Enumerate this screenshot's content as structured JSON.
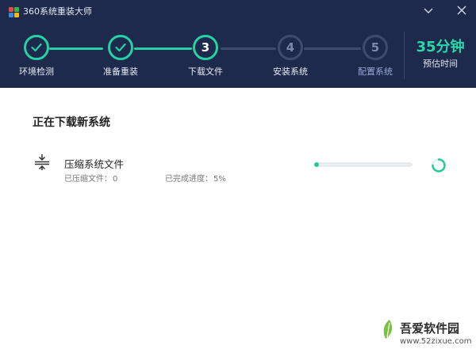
{
  "window": {
    "title": "360系统重装大师",
    "minimize_icon": "chevron-down-icon",
    "close_icon": "close-icon"
  },
  "colors": {
    "header_bg": "#1d2a4b",
    "accent": "#26d1a5",
    "pending": "#3f4b6e",
    "pending_text": "#7d88a8"
  },
  "steps": [
    {
      "label": "环境检测",
      "status": "done",
      "number": ""
    },
    {
      "label": "准备重装",
      "status": "done",
      "number": ""
    },
    {
      "label": "下载文件",
      "status": "active",
      "number": "3"
    },
    {
      "label": "安装系统",
      "status": "pending",
      "number": "4"
    },
    {
      "label": "配置系统",
      "status": "pending",
      "number": "5"
    }
  ],
  "estimate": {
    "value": "35分钟",
    "label": "预估时间"
  },
  "main": {
    "title": "正在下载新系统",
    "task": {
      "icon": "compress-icon",
      "name": "压缩系统文件",
      "files_label": "已压缩文件：",
      "files_value": "0",
      "progress_label": "已完成进度：",
      "progress_value": "5%",
      "progress_fraction": 0.05
    }
  },
  "watermark": {
    "brand": "吾爱软件园",
    "url": "www.52zixue.com"
  }
}
